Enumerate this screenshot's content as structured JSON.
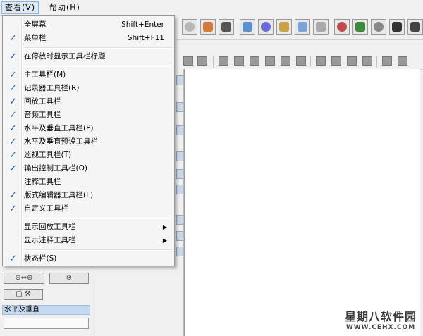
{
  "menubar": {
    "view": "查看(V)",
    "help": "帮助(H)"
  },
  "view_menu": {
    "items": [
      {
        "label": "全屏幕",
        "shortcut": "Shift+Enter",
        "checked": false
      },
      {
        "label": "菜单栏",
        "shortcut": "Shift+F11",
        "checked": true
      },
      {
        "label": "在停放时显示工具栏标题",
        "checked": true
      },
      {
        "label": "主工具栏(M)",
        "checked": true
      },
      {
        "label": "记录器工具栏(R)",
        "checked": true
      },
      {
        "label": "回放工具栏",
        "checked": true
      },
      {
        "label": "音频工具栏",
        "checked": true
      },
      {
        "label": "水平及垂直工具栏(P)",
        "checked": true
      },
      {
        "label": "水平及垂直预设工具栏",
        "checked": true
      },
      {
        "label": "巡视工具栏(T)",
        "checked": true
      },
      {
        "label": "输出控制工具栏(O)",
        "checked": true
      },
      {
        "label": "注释工具栏",
        "checked": false
      },
      {
        "label": "版式编辑器工具栏(L)",
        "checked": true
      },
      {
        "label": "自定义工具栏",
        "checked": true
      },
      {
        "label": "显示回放工具栏",
        "submenu": true,
        "checked": false
      },
      {
        "label": "显示注释工具栏",
        "submenu": true,
        "checked": false
      },
      {
        "label": "状态栏(S)",
        "checked": true
      }
    ]
  },
  "left_panel": {
    "header": "水平及垂直"
  },
  "watermark": {
    "line1": "星期八软件园",
    "line2": "WWW.CEHX.COM"
  },
  "colors": {
    "accent": "#1f5fb0",
    "panel_header": "#c4d9ef",
    "work_bg": "#ffffff"
  }
}
